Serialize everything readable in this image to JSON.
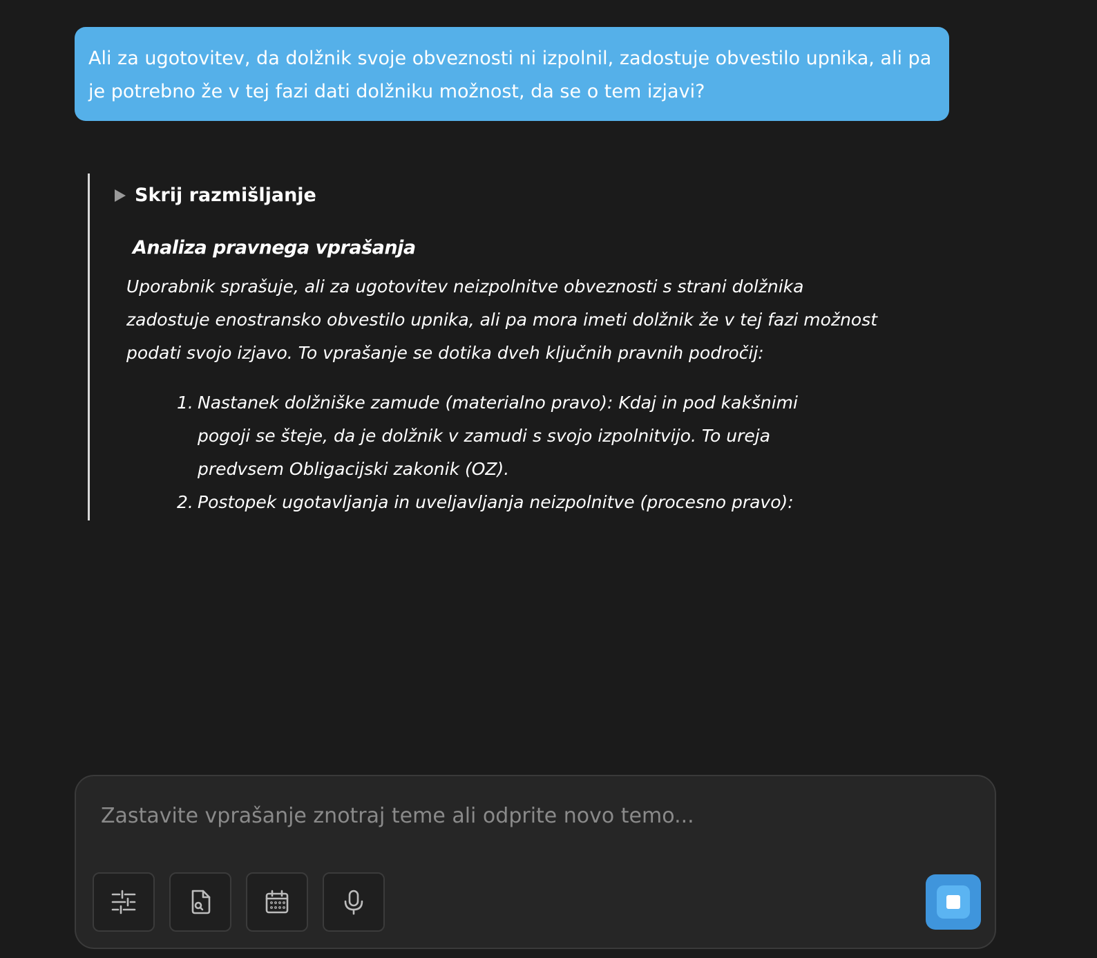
{
  "user_message": {
    "text": "Ali za ugotovitev, da dolžnik svoje obveznosti ni izpolnil, zadostuje obvestilo upnika, ali pa je potrebno že v tej fazi dati dolžniku možnost, da se o tem izjavi?"
  },
  "thinking": {
    "toggle_label": "Skrij razmišljanje",
    "heading": "Analiza pravnega vprašanja",
    "paragraph": "Uporabnik sprašuje, ali za ugotovitev neizpolnitve obveznosti s strani dolžnika zadostuje enostransko obvestilo upnika, ali pa mora imeti dolžnik že v tej fazi možnost podati svojo izjavo. To vprašanje se dotika dveh ključnih pravnih področij:",
    "items": [
      {
        "number": "1.",
        "text": "Nastanek dolžniške zamude (materialno pravo): Kdaj in pod kakšnimi pogoji se šteje, da je dolžnik v zamudi s svojo izpolnitvijo. To ureja predvsem Obligacijski zakonik (OZ)."
      },
      {
        "number": "2.",
        "text": "Postopek ugotavljanja in uveljavljanja neizpolnitve (procesno pravo):"
      }
    ]
  },
  "composer": {
    "placeholder": "Zastavite vprašanje znotraj teme ali odprite novo temo...",
    "value": "",
    "tools": [
      {
        "icon": "sliders-icon"
      },
      {
        "icon": "file-search-icon"
      },
      {
        "icon": "calendar-icon"
      },
      {
        "icon": "microphone-icon"
      }
    ],
    "stop_icon": "stop-icon"
  },
  "colors": {
    "background": "#1b1b1b",
    "user_bubble": "#55b0e9",
    "composer_bg": "#262626",
    "accent": "#3f95dc"
  }
}
